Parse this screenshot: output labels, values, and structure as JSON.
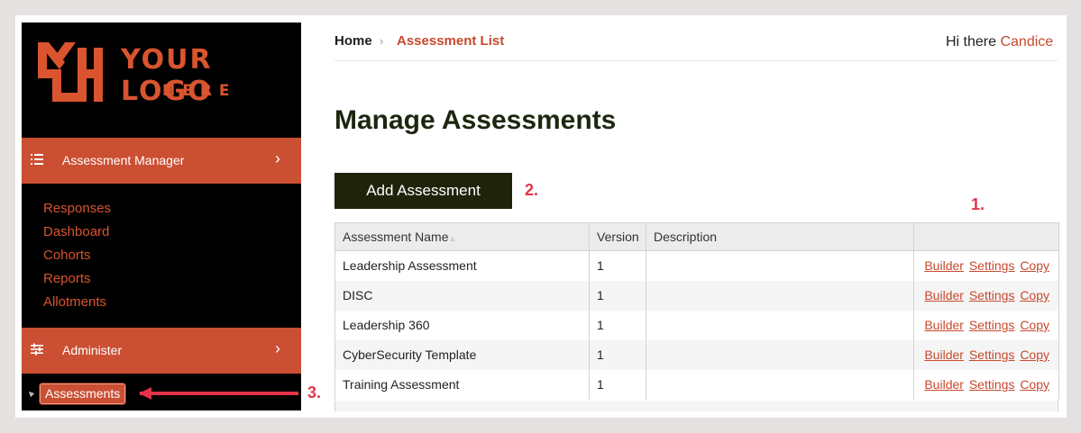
{
  "logo": {
    "mark": "YH",
    "line1": "YOUR LOGO",
    "line2": "HERE",
    "color": "#d9542f"
  },
  "sidebar": {
    "assessment_manager": {
      "label": "Assessment Manager",
      "chevron": "›"
    },
    "sub_items": [
      {
        "label": "Responses"
      },
      {
        "label": "Dashboard"
      },
      {
        "label": "Cohorts"
      },
      {
        "label": "Reports"
      },
      {
        "label": "Allotments"
      }
    ],
    "administer": {
      "label": "Administer",
      "chevron": "›"
    },
    "assessments": {
      "label": "Assessments"
    }
  },
  "breadcrumb": {
    "home": "Home",
    "sep": "›",
    "current": "Assessment List"
  },
  "greeting": {
    "prefix": "Hi there ",
    "user": "Candice"
  },
  "page": {
    "title": "Manage Assessments",
    "add_button": "Add Assessment"
  },
  "annotations": {
    "one": "1.",
    "two": "2.",
    "three": "3."
  },
  "table": {
    "headers": [
      "Assessment Name",
      "Version",
      "Description",
      ""
    ],
    "rows": [
      {
        "name": "Leadership Assessment",
        "version": "1",
        "description": ""
      },
      {
        "name": "DISC",
        "version": "1",
        "description": ""
      },
      {
        "name": "Leadership 360",
        "version": "1",
        "description": ""
      },
      {
        "name": "CyberSecurity Template",
        "version": "1",
        "description": ""
      },
      {
        "name": "Training Assessment",
        "version": "1",
        "description": ""
      }
    ],
    "actions": {
      "builder": "Builder",
      "settings": "Settings",
      "copy": "Copy"
    }
  },
  "colors": {
    "accent": "#c7492e",
    "sidebar_bar": "#cb4f33",
    "dark_button": "#1e2309",
    "annotation": "#e5344a"
  }
}
